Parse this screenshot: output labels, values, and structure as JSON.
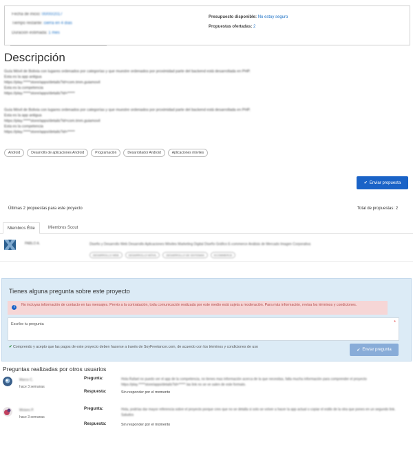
{
  "summary": {
    "start_label": "Fecha de inicio:",
    "start_value": "00/00/2017",
    "remaining_label": "Tiempo restante:",
    "remaining_value": "cierra en 4 días",
    "duration_label": "Duración estimada:",
    "duration_value": "1 mes",
    "budget_label": "Presupuesto disponible:",
    "budget_value": "No estoy seguro",
    "offers_label": "Propuestas ofertadas:",
    "offers_value": "2"
  },
  "description": {
    "title": "Descripción",
    "block1": [
      "Guía Móvil de Bolivia con lugares ordenados por categorías y que muestre ordenados por proximidad parte del backend está desarrollada en PHP.",
      "Esta es la app antigua",
      "https://play.*****store/apps/details?id=com.tmm.guiamovil",
      "Esta es la competencia",
      "https://play.*****store/apps/details?id=*****"
    ],
    "block2": [
      "Guía Móvil de Bolivia con lugares ordenados por categorías y que muestre ordenados por proximidad parte del backend está desarrollada en PHP.",
      "Esta es la app antigua",
      "https://play.*****store/apps/details?id=com.tmm.guiamovil",
      "Esta es la competencia",
      "https://play.*****store/apps/details?id=*****"
    ]
  },
  "tags": [
    "Android",
    "Desarrollo de aplicaciones Android",
    "Programación",
    "Desarrollador Android",
    "Aplicaciones móviles"
  ],
  "send_proposal_label": "Enviar propuesta",
  "proposals": {
    "last_label": "Últimas 2 propuestas para este proyecto",
    "total_label": "Total de propuestas: 2"
  },
  "tabs": [
    "Miembros Élite",
    "Miembros Scout"
  ],
  "member": {
    "name": "PABLO A.",
    "skills": "Diseño y Desarrollo Web Desarrollo Aplicaciones Móviles Marketing Digital Diseño Gráfico E-commerce Análisis de Mercado Imagen Corporativa",
    "chips": [
      "DESARROLLO WEB",
      "DESARROLLO MÓVIL",
      "DESARROLLO DE SISTEMAS",
      "ECOMMERCE"
    ]
  },
  "qa": {
    "title": "Tienes alguna pregunta sobre este proyecto",
    "alert": "No incluyas información de contacto en tus mensajes. Previo a la contratación, toda comunicación realizada por este medio está sujeta a moderación. Para más información, revisa los términos y condiciones.",
    "placeholder": "Escribe tu pregunta",
    "required_mark": "*",
    "terms": "Comprendo y acepto que las pagos de este proyecto deben hacerse a través de SoyFreelancer.com, de acuerdo con los términos y condiciones de uso",
    "send_label": "Enviar pregunta"
  },
  "asked": {
    "title": "Preguntas realizadas por otros usuarios",
    "question_label": "Pregunta:",
    "answer_label": "Respuesta:",
    "items": [
      {
        "name": "Marco C.",
        "when": "hace 3 semanas",
        "question": "Hola Rafael no puedo ver el app de la competencia, no tienes mas información acerca de la que necesitas, falta mucha información para comprender el proyecto https://play.*****store/apps/details?id=***** las link no se ve salen de este formato.",
        "answer": "Sin responder por el momento"
      },
      {
        "name": "Moises P.",
        "when": "hace 3 semanas",
        "question": "Hola, podrías dar mayor referencia sobre el proyecto porque creo que no se detalla si solo se volver a hacer la app actual o copiar el estilo de la otra que pones en un segundo link. Saludos",
        "answer": "Sin responder por el momento"
      }
    ]
  },
  "colors": {
    "accent": "#1a63c7",
    "qa_bg": "#dcebf6",
    "alert_bg": "#f6d6d6"
  }
}
